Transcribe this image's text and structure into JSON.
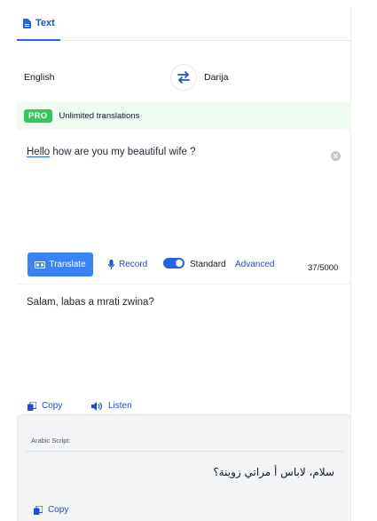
{
  "tabs": {
    "text_label": "Text"
  },
  "languages": {
    "source": "English",
    "target": "Darija"
  },
  "pro": {
    "badge": "PRO",
    "text": "Unlimited translations"
  },
  "input": {
    "word_1": "Hello",
    "rest": " how are you my beautiful wife ?"
  },
  "controls": {
    "translate_label": "Translate",
    "record_label": "Record",
    "standard_label": "Standard",
    "advanced_label": "Advanced",
    "char_count": "37/5000"
  },
  "output": {
    "text": "Salam, labas a mrati zwina?",
    "copy_label": "Copy",
    "listen_label": "Listen"
  },
  "arabic_script": {
    "label": "Arabic Script:",
    "text": "سلام، لاباس أ مراتي زوينة؟",
    "copy_label": "Copy"
  },
  "colors": {
    "accent": "#2563eb",
    "pro_green": "#34c759",
    "pro_bg": "#effaf0",
    "button_blue": "#3b82f6"
  }
}
